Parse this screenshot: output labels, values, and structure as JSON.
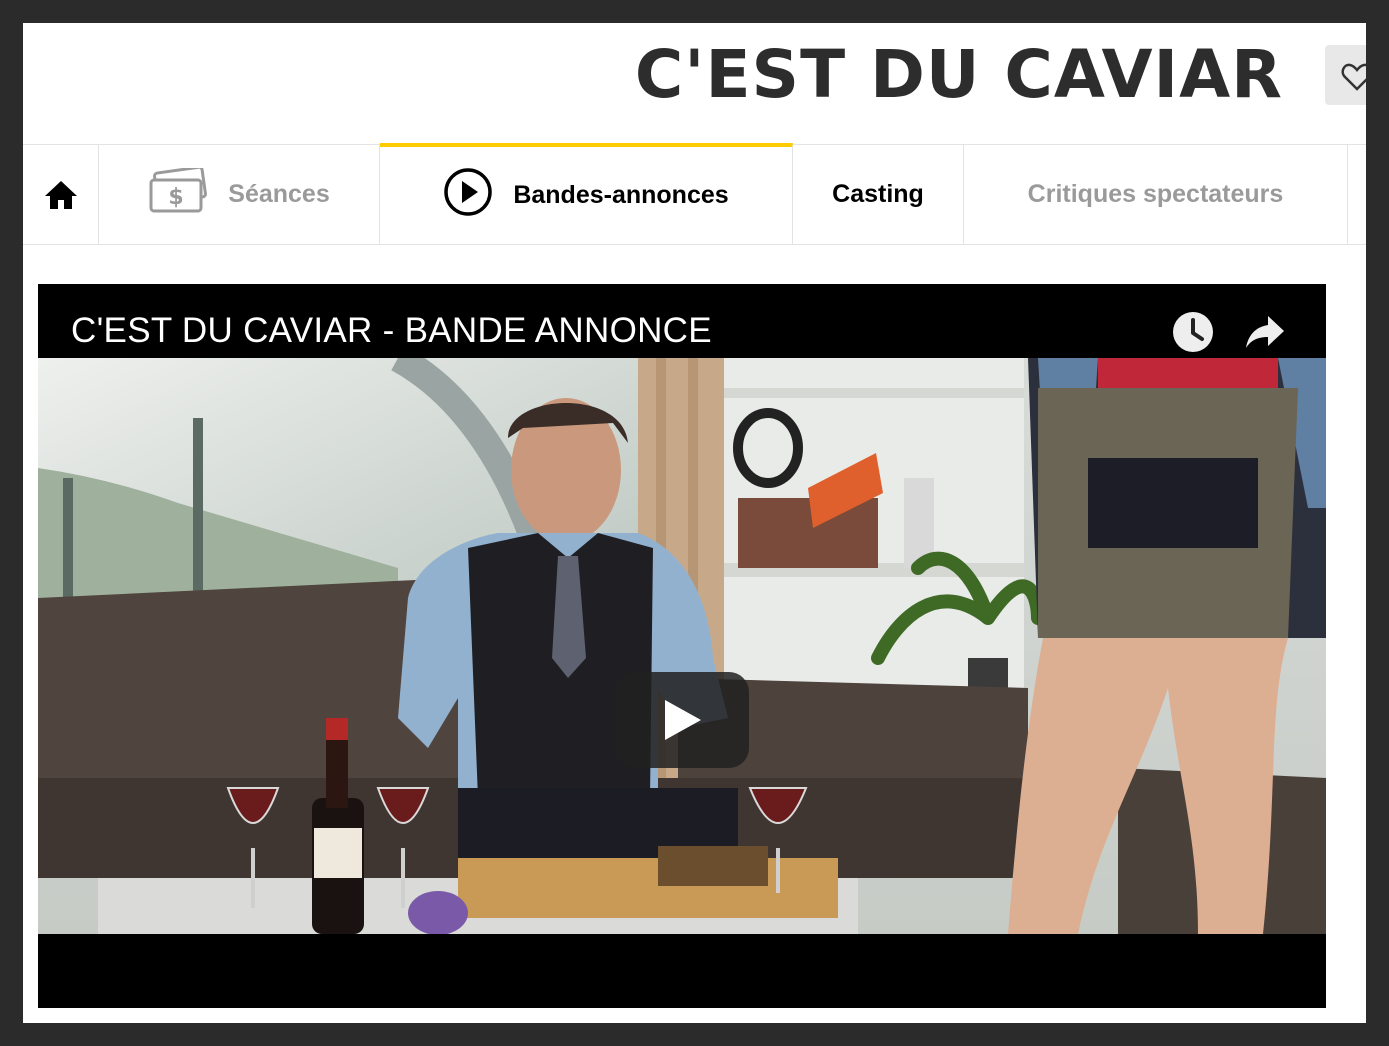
{
  "header": {
    "title": "C'EST DU CAVIAR"
  },
  "tabs": [
    {
      "id": "home",
      "label": ""
    },
    {
      "id": "seances",
      "label": "Séances"
    },
    {
      "id": "bandes",
      "label": "Bandes-annonces"
    },
    {
      "id": "casting",
      "label": "Casting"
    },
    {
      "id": "critiques",
      "label": "Critiques spectateurs"
    }
  ],
  "player": {
    "title": "C'EST DU CAVIAR - BANDE ANNONCE"
  },
  "colors": {
    "accent": "#fecc00",
    "title": "#2d2d2d",
    "muted_tab": "#9a9a9a",
    "backdrop": "#2b2b2b"
  },
  "icons": [
    "heart-icon",
    "home-icon",
    "tickets-icon",
    "play-circle-icon",
    "clock-icon",
    "share-icon",
    "play-icon"
  ]
}
